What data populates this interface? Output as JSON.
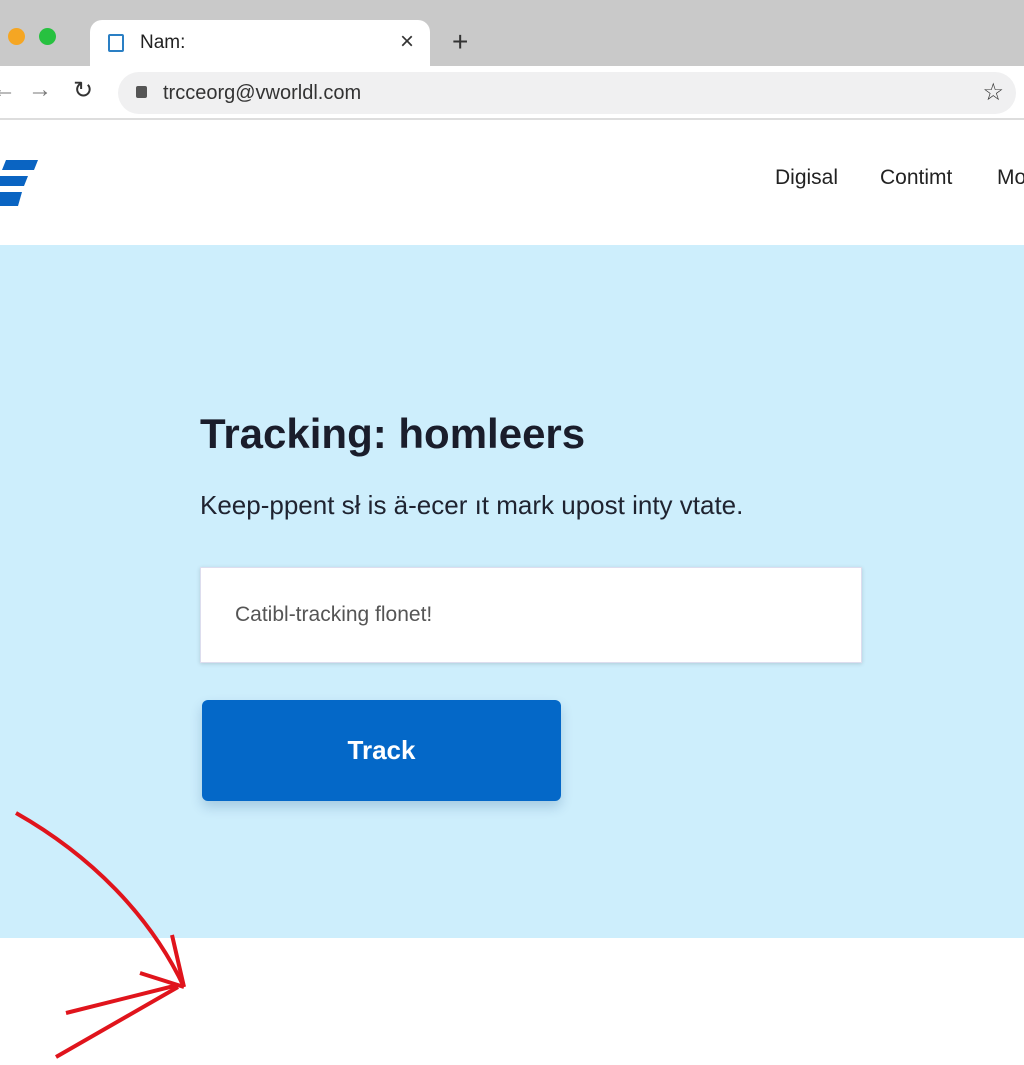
{
  "browser": {
    "tab_title": "Nam:",
    "url": "trcceorg@vworldl.com",
    "new_tab_label": "+",
    "close_label": "×"
  },
  "site": {
    "nav": [
      "Digisal",
      "Contimt",
      "Mo"
    ]
  },
  "hero": {
    "title": "Tracking: homleers",
    "subtitle": "Keep-ppent sł is ä-ecer ıt mark upost inty vtate.",
    "input_value": "Catibl-tracking flonet!",
    "button_label": "Track"
  },
  "colors": {
    "accent": "#0468c8",
    "hero_bg": "#cdeefc",
    "annotation_arrow": "#e0141c"
  }
}
